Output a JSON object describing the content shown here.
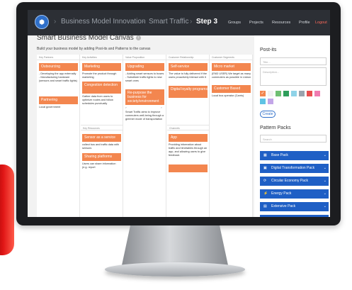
{
  "header": {
    "logo_glyph": "⬢",
    "breadcrumb_sep": "›",
    "breadcrumb": [
      "Business Model Innovation",
      "Smart Traffic",
      "Step 3"
    ],
    "nav": [
      "Groups",
      "Projects",
      "Resources",
      "Profile",
      "Logout"
    ]
  },
  "main": {
    "title": "Smart Business Model Canvas",
    "info_glyph": "i",
    "subtitle": "Build your business model by adding Post-its and Patterns to the canvas"
  },
  "canvas": {
    "columns": [
      "Key Partners",
      "Key Activities",
      "Value Proposition",
      "Customer Relationship",
      "Customer Segments"
    ],
    "resources_head": "Key Resources",
    "channels_head": "Channels",
    "resize_marks": [
      "⌐",
      "⌐"
    ],
    "key_partners": {
      "n1": "Outsourcing",
      "t1": "- Developing the app externally\n- Manufacturing hardware (sensors and smart traffic lights)",
      "n2": "Partnering",
      "t2": "Local government"
    },
    "key_activities": {
      "n1": "Marketing",
      "t1": "Promote the product through marketing",
      "n2": "Congestion detection",
      "t2": "Gather data from users to optimize routes and follow schedules punctually"
    },
    "key_resources": {
      "n1": "Sensor as a service",
      "t1": "collect bus and traffic data with sensors",
      "n2": "Sharing platforms",
      "t2": "Users can share information (e.g. report"
    },
    "value_proposition": {
      "n1": "Upgrading",
      "t1": "- Adding smart sensors to buses\n- Substitute traffic lights to new smart ones",
      "n2": "Re-purpose the business for society/environment",
      "t2": "Smart Traffic aims to improve commuters well-being through a greener mode of transportation"
    },
    "customer_relationship": {
      "n1": "Self-service",
      "t1": "The value is fully delivered if the users proactively interact with it",
      "n2": "Digital loyalty programs"
    },
    "channels": {
      "n1": "App",
      "t1": "Providing information about traffic and timetables through an app, and allowing users to give feedback"
    },
    "customer_segments": {
      "n1": "Micro market",
      "t1": "(END USER) We target as many commuters as possible in Lisbon",
      "n2": "Customer Based",
      "t2": "Local bus operator (Carris)"
    }
  },
  "sidebar": {
    "postits_title": "Post-its",
    "title_placeholder": "Title...",
    "desc_placeholder": "Description...",
    "check_glyph": "✓",
    "swatch_colors": [
      "#f3864f",
      "#f2f2f2",
      "#6fbf73",
      "#2e9e5b",
      "#8fd3e8",
      "#9aa3ad",
      "#e94f4f",
      "#f07bb0",
      "#5fc3e4",
      "#c3a6e8"
    ],
    "create_label": "Create",
    "packs_title": "Pattern Packs",
    "search_placeholder": "Search",
    "packs": [
      "Base Pack",
      "Digital Transformation Pack",
      "Circular Economy Pack",
      "Energy Pack",
      "Extensive Pack",
      "Sustainability Pack"
    ],
    "pack_icons": [
      "▦",
      "▣",
      "⟳",
      "⚡",
      "▤",
      "♻"
    ],
    "chevron": "⌄"
  },
  "colors": {
    "accent": "#1f5fc5",
    "note": "#f3864f",
    "topbar": "#2c2f35"
  }
}
